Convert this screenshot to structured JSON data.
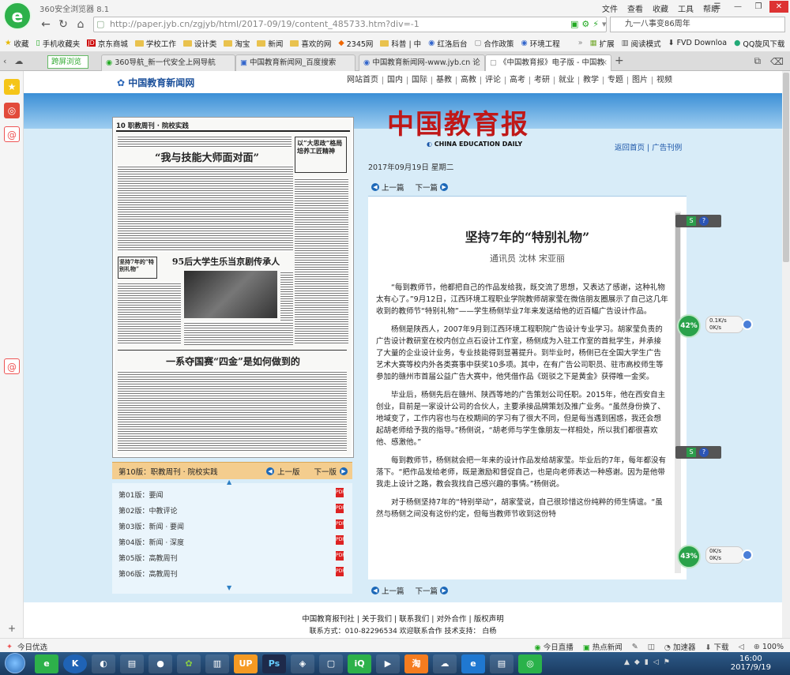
{
  "browser": {
    "app_title": "360安全浏览器 8.1",
    "menu": [
      "文件",
      "查看",
      "收藏",
      "工具",
      "帮助"
    ],
    "url": "http://paper.jyb.cn/zgjyb/html/2017-09/19/content_485733.htm?div=-1",
    "search_value": "九一八事变86周年",
    "split_label": "跨屏浏览",
    "bookmarks": [
      "收藏",
      "手机收藏夹",
      "京东商城",
      "学校工作",
      "设计类",
      "淘宝",
      "新闻",
      "喜欢的网",
      "2345网",
      "科普 | 中",
      "红洛后台",
      "合作政策",
      "环境工程"
    ],
    "bookmarks_right": [
      "扩展",
      "阅读模式",
      "FVD Downloa",
      "QQ旋风下载"
    ],
    "tabs": [
      {
        "label": "360导航_新一代安全上网导航",
        "active": false
      },
      {
        "label": "中国教育新闻网_百度搜索",
        "active": false
      },
      {
        "label": "中国教育新闻网-www.jyb.cn 论",
        "active": false
      },
      {
        "label": "《中国教育报》电子版 - 中国教",
        "active": true
      }
    ]
  },
  "site": {
    "logo": "中国教育新闻网",
    "nav": [
      "网站首页",
      "国内",
      "国际",
      "基教",
      "高教",
      "评论",
      "高考",
      "考研",
      "就业",
      "教学",
      "专题",
      "图片",
      "视频"
    ],
    "masthead": "中国教育报",
    "masthead_en": "CHINA EDUCATION DAILY",
    "top_links": "返回首页 | 广告刊例",
    "date": "2017年09月19日  星期二"
  },
  "paper": {
    "header": "10 职教周刊 · 院校实践",
    "headline1": "“我与技能大师面对面”",
    "headline2": "95后大学生乐当京剧传承人",
    "headline3": "一系夺国赛“四金”是如何做到的",
    "side_head": "以“大思政”格局培养工匠精神",
    "side_head2": "坚持7年的“特别礼物”",
    "current_edition": "第10版：职教周刊 · 院校实践",
    "prev": "上一版",
    "next": "下一版",
    "editions": [
      "第01版：要闻",
      "第02版：中教评论",
      "第03版：新闻 · 要闻",
      "第04版：新闻 · 深度",
      "第05版：高教周刊",
      "第06版：高教周刊"
    ]
  },
  "article": {
    "prev": "上一篇",
    "next": "下一篇",
    "title": "坚持7年的“特别礼物”",
    "byline": "通讯员  沈林  宋亚丽",
    "paragraphs": [
      "“每到教师节，他都把自己的作品发给我，既交流了思想，又表达了感谢，这种礼物太有心了。”9月12日，江西环境工程职业学院教师胡家莹在微信朋友圈展示了自己这几年收到的教师节“特别礼物”——学生杨侧毕业7年来发送给他的近百幅广告设计作品。",
      "杨侧是陕西人，2007年9月到江西环境工程职院广告设计专业学习。胡家莹负责的广告设计教研室在校内创立点石设计工作室，杨侧成为入驻工作室的首批学生，并承接了大量的企业设计业务，专业技能得到显著提升。到毕业时，杨侧已在全国大学生广告艺术大赛等校内外各类赛事中获奖10多项。其中，在有广告公司职员、驻市高校师生等参加的赣州市首届公益广告大赛中，他凭借作品《斑驳之下是黄金》获得唯一金奖。",
      "毕业后，杨侧先后在赣州、陕西等地的广告策划公司任职。2015年，他在西安自主创业，目前是一家设计公司的合伙人，主要承接品牌策划及推广业务。“虽然身份换了、地域变了，工作内容也与在校期间的学习有了很大不同，但是每当遇到困惑，我还会想起胡老师给予我的指导。”杨侧说，“胡老师与学生像朋友一样相处，所以我们都很喜欢他、感激他。”",
      "每到教师节，杨侧就会把一年来的设计作品发给胡家莹。毕业后的7年，每年都没有落下。“把作品发给老师，既是激励和督促自己，也是向老师表达一种感谢。因为是他带我走上设计之路，教会我找自己感兴趣的事情。”杨侧说。",
      "对于杨侧坚持7年的“特别举动”，胡家莹说，自己很珍惜这份纯粹的师生情谊。“虽然与杨侧之间没有这份约定，但每当教师节收到这份特"
    ]
  },
  "net_widgets": [
    {
      "percent": "42%",
      "up": "0.1K/s",
      "down": "0K/s"
    },
    {
      "percent": "43%",
      "up": "0K/s",
      "down": "0K/s"
    }
  ],
  "footer": {
    "links": "中国教育报刊社  |  关于我们  |  联系我们  |  对外合作  |  版权声明",
    "contact": "联系方式：010-82296534  欢迎联系合作  技术支持：  白杨"
  },
  "status": {
    "left": "今日优选",
    "right": [
      "今日直播",
      "热点新闻",
      "加速器",
      "下载",
      "100%"
    ]
  },
  "taskbar": {
    "time": "16:00",
    "date": "2017/9/19"
  }
}
